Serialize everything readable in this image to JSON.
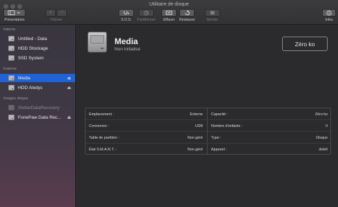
{
  "window": {
    "title": "Utilitaire de disque"
  },
  "toolbar": {
    "presentation": "Présentation",
    "volume": "Volume",
    "sos": "S.O.S.",
    "partition": "Partitionner",
    "erase": "Effacer",
    "restore": "Restaurer",
    "mount": "Monter",
    "info": "Infos",
    "add_glyph": "+",
    "remove_glyph": "−"
  },
  "sidebar": {
    "sections": [
      {
        "label": "Interne"
      },
      {
        "label": "Externe"
      },
      {
        "label": "Images disque"
      }
    ],
    "internal": [
      {
        "label": "Untitled - Data"
      },
      {
        "label": "HDD Stockage"
      },
      {
        "label": "SSD System"
      }
    ],
    "external": [
      {
        "label": "Media",
        "selected": true
      },
      {
        "label": "HDD Aledys"
      }
    ],
    "images": [
      {
        "label": "StellarDataRecovery"
      },
      {
        "label": "FonePaw Data Rec..."
      }
    ],
    "eject_glyph": "⏏"
  },
  "volume": {
    "name": "Media",
    "status": "Non initialisé",
    "capacity": "Zéro ko"
  },
  "info": {
    "left": [
      {
        "label": "Emplacement :",
        "value": "Externe"
      },
      {
        "label": "Connexion :",
        "value": "USB"
      },
      {
        "label": "Table de partition :",
        "value": "Non géré"
      },
      {
        "label": "État S.M.A.R.T. :",
        "value": "Non géré"
      }
    ],
    "right": [
      {
        "label": "Capacité :",
        "value": "Zéro ko"
      },
      {
        "label": "Nombre d'enfants :",
        "value": "0"
      },
      {
        "label": "Type :",
        "value": "Disque"
      },
      {
        "label": "Appareil :",
        "value": "disk6"
      }
    ]
  },
  "colors": {
    "accent": "#1f63d6",
    "background": "#2b2b2d"
  }
}
